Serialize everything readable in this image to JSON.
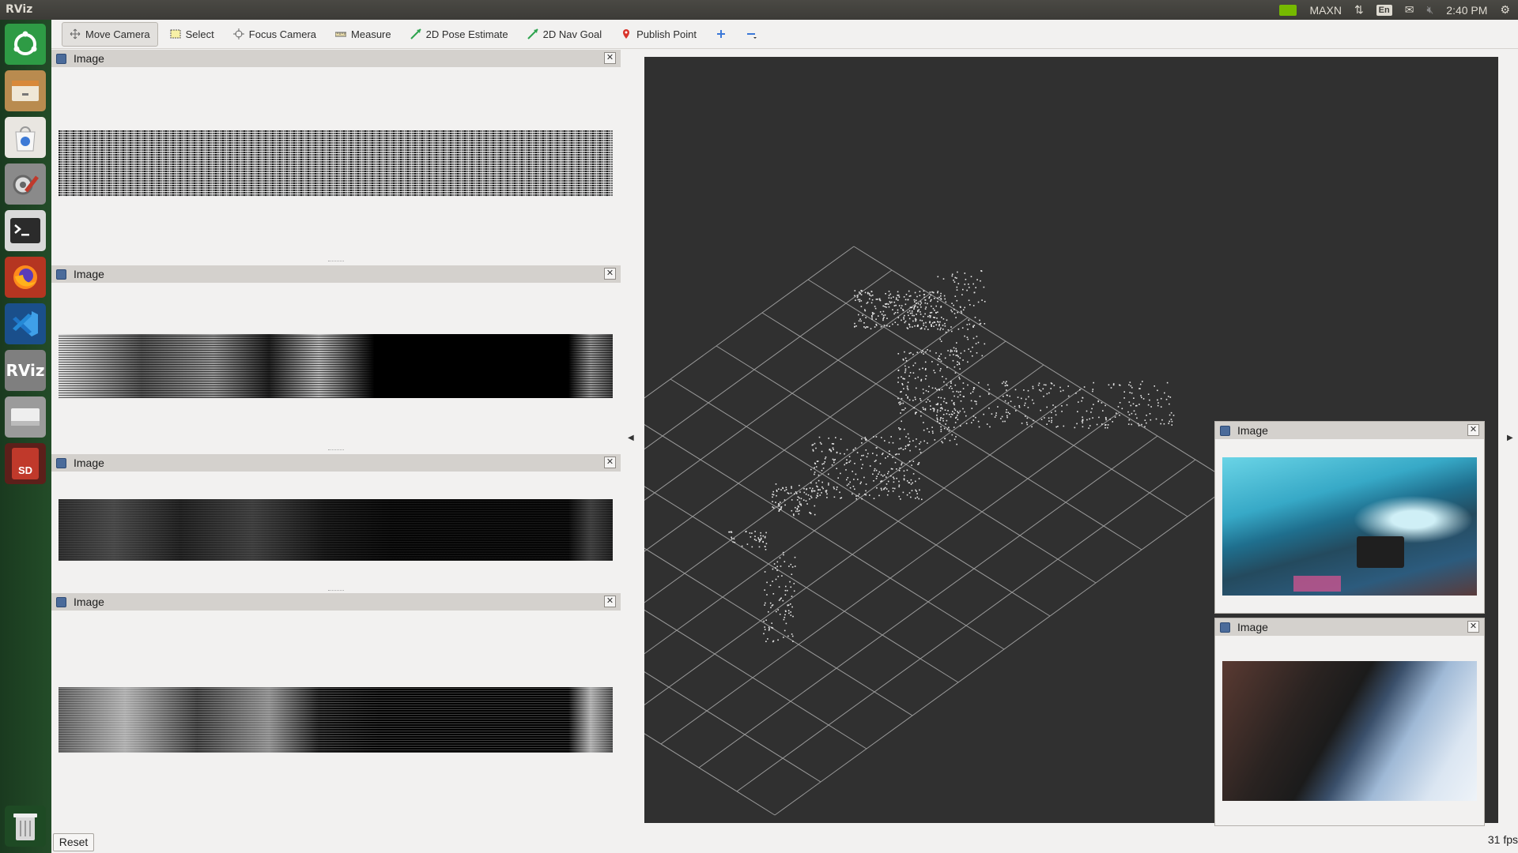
{
  "window": {
    "title": "RViz"
  },
  "system_tray": {
    "power_mode": "MAXN",
    "keyboard_layout": "En",
    "clock": "2:40 PM"
  },
  "launcher": {
    "items": [
      {
        "name": "ubuntu-dash",
        "color": "#2e9b45"
      },
      {
        "name": "files",
        "color": "#c8a063"
      },
      {
        "name": "software-center",
        "color": "#e9e6e1"
      },
      {
        "name": "system-settings",
        "color": "#b0392e"
      },
      {
        "name": "terminal",
        "color": "#2b2b2b"
      },
      {
        "name": "firefox",
        "color": "#ff7a18"
      },
      {
        "name": "vscode",
        "color": "#1f6fb5"
      },
      {
        "name": "rviz",
        "label": "RViz",
        "color": "#9c9c9c"
      },
      {
        "name": "drive",
        "color": "#cfcfcf"
      },
      {
        "name": "sd-card",
        "label": "SD",
        "color": "#c0392b"
      }
    ]
  },
  "toolbar": {
    "tools": [
      {
        "label": "Move Camera",
        "active": true,
        "icon": "move-camera-icon"
      },
      {
        "label": "Select",
        "active": false,
        "icon": "select-icon"
      },
      {
        "label": "Focus Camera",
        "active": false,
        "icon": "focus-camera-icon"
      },
      {
        "label": "Measure",
        "active": false,
        "icon": "measure-icon"
      },
      {
        "label": "2D Pose Estimate",
        "active": false,
        "icon": "pose-estimate-icon"
      },
      {
        "label": "2D Nav Goal",
        "active": false,
        "icon": "nav-goal-icon"
      },
      {
        "label": "Publish Point",
        "active": false,
        "icon": "publish-point-icon"
      }
    ]
  },
  "left_panels": [
    {
      "title": "Image"
    },
    {
      "title": "Image"
    },
    {
      "title": "Image"
    },
    {
      "title": "Image"
    }
  ],
  "floating_panels": [
    {
      "title": "Image"
    },
    {
      "title": "Image"
    }
  ],
  "reset_label": "Reset",
  "fps": "31 fps"
}
